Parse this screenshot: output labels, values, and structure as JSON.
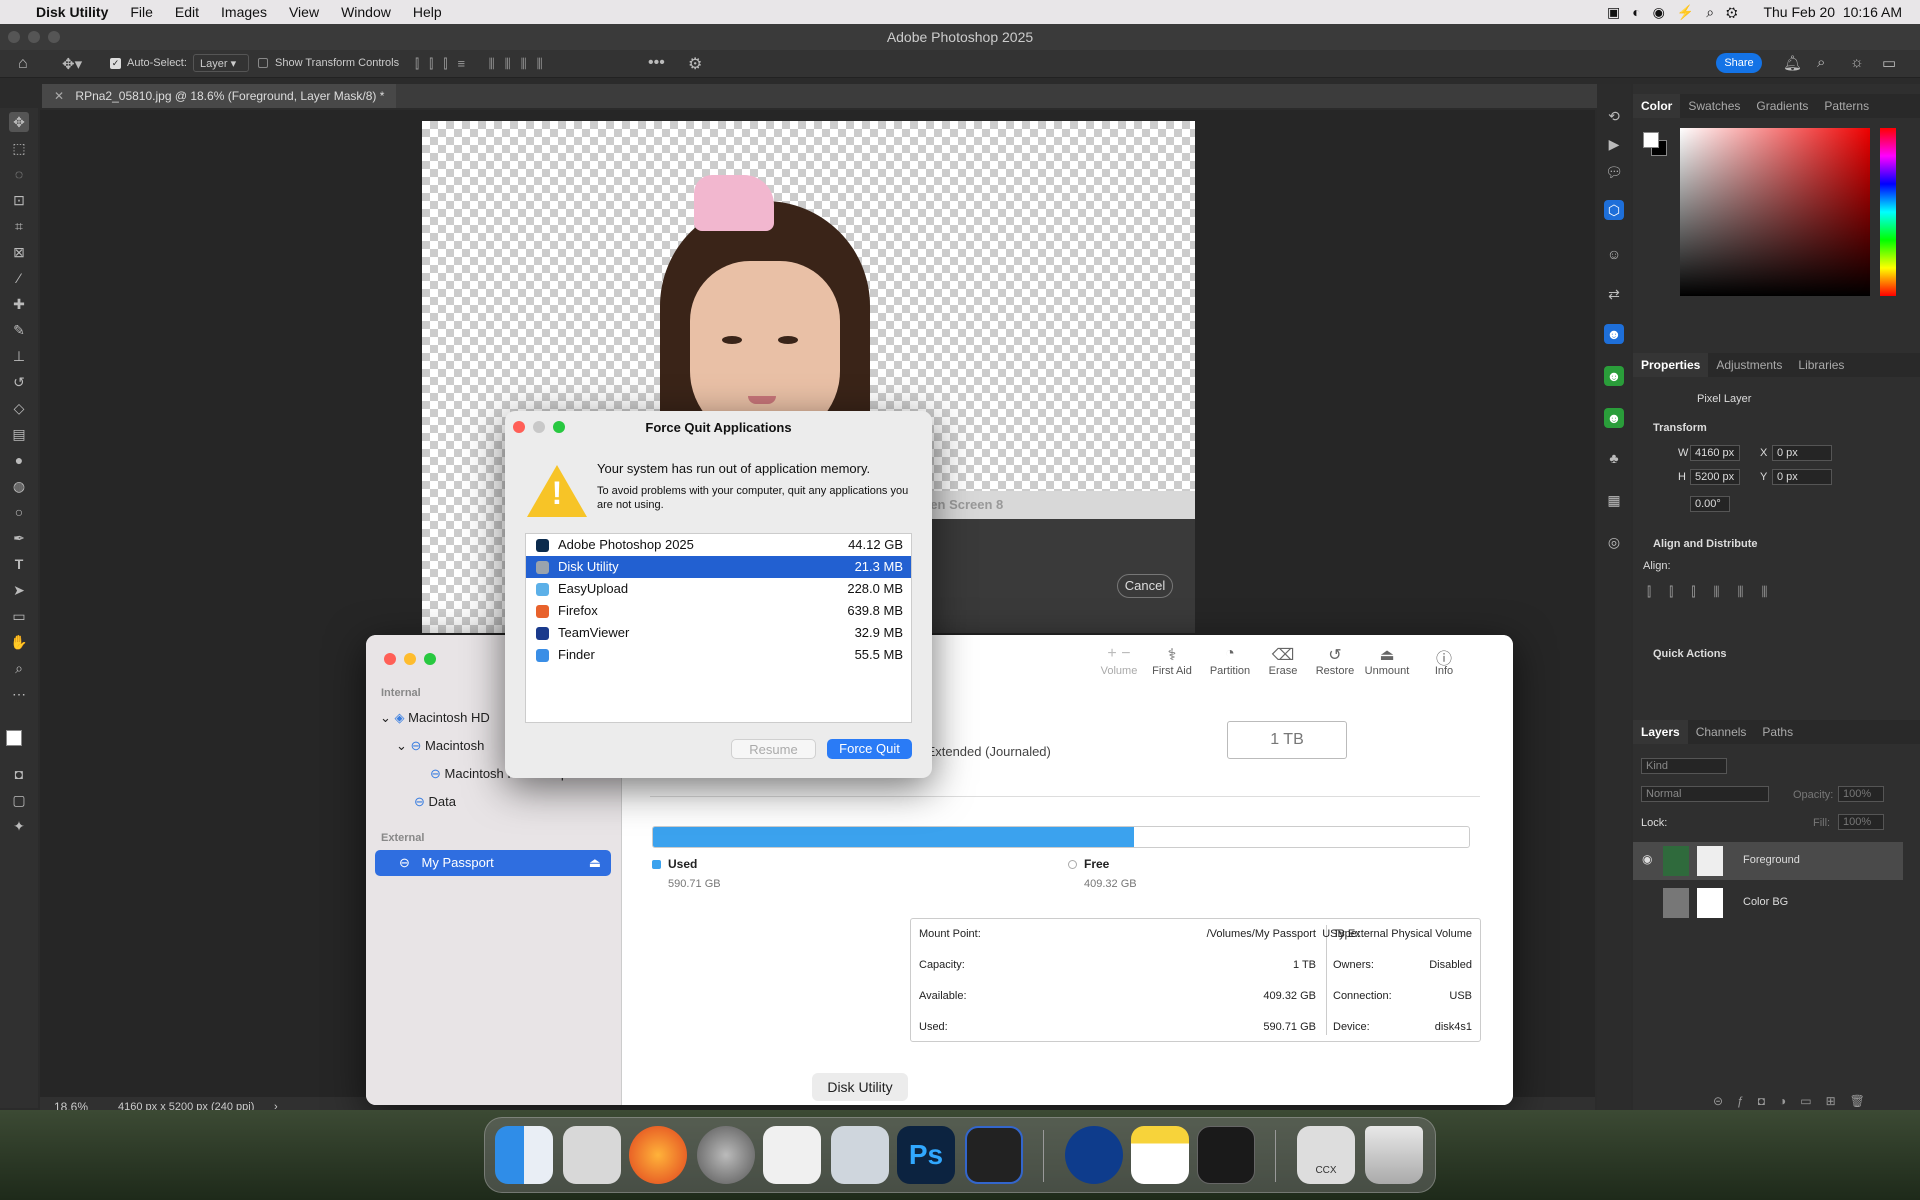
{
  "menubar": {
    "app": "Disk Utility",
    "items": [
      "File",
      "Edit",
      "Images",
      "View",
      "Window",
      "Help"
    ],
    "clock": "Thu Feb 20  10:16 AM"
  },
  "photoshop": {
    "title": "Adobe Photoshop 2025",
    "options": {
      "auto_select_label": "Auto-Select:",
      "auto_select_value": "Layer",
      "show_transform_label": "Show Transform Controls",
      "share_label": "Share"
    },
    "doc_tab": "RPna2_05810.jpg @ 18.6% (Foreground, Layer Mask/8) *",
    "status": {
      "zoom": "18.6%",
      "size": "4160 px x 5200 px (240 ppi)"
    },
    "hidden_dialog": {
      "title_fragment": "reen Screen 8",
      "cancel": "Cancel"
    },
    "color_tabs": [
      "Color",
      "Swatches",
      "Gradients",
      "Patterns"
    ],
    "props_tabs": [
      "Properties",
      "Adjustments",
      "Libraries"
    ],
    "props": {
      "kind": "Pixel Layer",
      "transform": "Transform",
      "w_label": "W",
      "w": "4160 px",
      "h_label": "H",
      "h": "5200 px",
      "x_label": "X",
      "x": "0 px",
      "y_label": "Y",
      "y": "0 px",
      "angle": "0.00°",
      "align": "Align and Distribute",
      "align_sub": "Align:",
      "quick": "Quick Actions"
    },
    "layers_tabs": [
      "Layers",
      "Channels",
      "Paths"
    ],
    "layers": {
      "kind": "Kind",
      "blend": "Normal",
      "opacity_label": "Opacity:",
      "opacity": "100%",
      "lock": "Lock:",
      "fill_label": "Fill:",
      "fill": "100%",
      "items": [
        "Foreground",
        "Color BG"
      ]
    }
  },
  "disk_utility": {
    "sidebar": {
      "internal": "Internal",
      "items": [
        "Macintosh HD",
        "Macintosh",
        "Macintosh HD - Snapshot",
        "Data"
      ],
      "external": "External",
      "selected": "My Passport"
    },
    "toolbar": [
      "Volume",
      "First Aid",
      "Partition",
      "Erase",
      "Restore",
      "Unmount",
      "Info"
    ],
    "format": "Mac OS Extended (Journaled)",
    "capacity_badge": "1 TB",
    "used_fraction": 0.59,
    "used_label": "Used",
    "used_value": "590.71 GB",
    "free_label": "Free",
    "free_value": "409.32 GB",
    "info_left": [
      {
        "k": "Mount Point:",
        "v": "/Volumes/My Passport"
      },
      {
        "k": "Capacity:",
        "v": "1 TB"
      },
      {
        "k": "Available:",
        "v": "409.32 GB"
      },
      {
        "k": "Used:",
        "v": "590.71 GB"
      }
    ],
    "info_right": [
      {
        "k": "Type:",
        "v": "USB External Physical Volume"
      },
      {
        "k": "Owners:",
        "v": "Disabled"
      },
      {
        "k": "Connection:",
        "v": "USB"
      },
      {
        "k": "Device:",
        "v": "disk4s1"
      }
    ]
  },
  "force_quit": {
    "title": "Force Quit Applications",
    "heading": "Your system has run out of application memory.",
    "body": "To avoid problems with your computer, quit any applications you are not using.",
    "apps": [
      {
        "name": "Adobe Photoshop 2025",
        "size": "44.12 GB",
        "color": "#0b2b4d"
      },
      {
        "name": "Disk Utility",
        "size": "21.3 MB",
        "color": "#9aa3ad"
      },
      {
        "name": "EasyUpload",
        "size": "228.0 MB",
        "color": "#5cb0e8"
      },
      {
        "name": "Firefox",
        "size": "639.8 MB",
        "color": "#e8622c"
      },
      {
        "name": "TeamViewer",
        "size": "32.9 MB",
        "color": "#1a3a8c"
      },
      {
        "name": "Finder",
        "size": "55.5 MB",
        "color": "#3a8ee6"
      }
    ],
    "selected_index": 1,
    "resume": "Resume",
    "force_quit": "Force Quit"
  },
  "dock": {
    "tooltip": "Disk Utility",
    "ccx_label": "CCX"
  }
}
